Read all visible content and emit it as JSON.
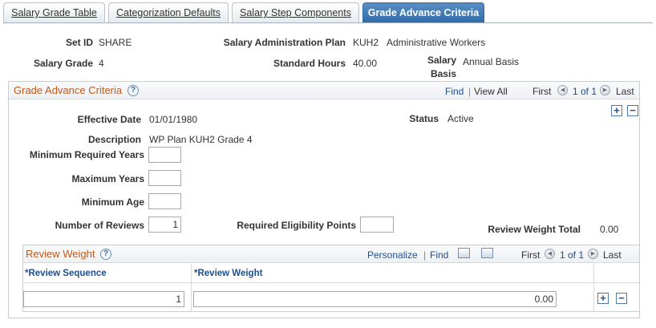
{
  "tabs": [
    {
      "label": "Salary Grade Table",
      "active": false
    },
    {
      "label": "Categorization Defaults",
      "active": false
    },
    {
      "label": "Salary Step Components",
      "active": false
    },
    {
      "label": "Grade Advance Criteria",
      "active": true
    }
  ],
  "header": {
    "setid_label": "Set ID",
    "setid_value": "SHARE",
    "sal_admin_plan_label": "Salary Administration Plan",
    "sal_admin_plan_code": "KUH2",
    "sal_admin_plan_desc": "Administrative Workers",
    "salary_grade_label": "Salary Grade",
    "salary_grade_value": "4",
    "std_hours_label": "Standard Hours",
    "std_hours_value": "40.00",
    "salary_basis_label_1": "Salary",
    "salary_basis_label_2": "Basis",
    "salary_basis_value": "Annual Basis"
  },
  "criteria": {
    "title": "Grade Advance Criteria",
    "help": "?",
    "find": "Find",
    "sep": "|",
    "view_all": "View All",
    "first": "First",
    "page_of": "1 of 1",
    "last": "Last",
    "add": "+",
    "remove": "−",
    "effective_date_label": "Effective Date",
    "effective_date_value": "01/01/1980",
    "status_label": "Status",
    "status_value": "Active",
    "description_label": "Description",
    "description_value": "WP Plan KUH2 Grade 4",
    "min_req_years_label": "Minimum Required Years",
    "min_req_years_value": "",
    "max_years_label": "Maximum Years",
    "max_years_value": "",
    "min_age_label": "Minimum Age",
    "min_age_value": "",
    "num_reviews_label": "Number of Reviews",
    "num_reviews_value": "1",
    "req_elig_points_label": "Required Eligibility Points",
    "req_elig_points_value": "",
    "review_weight_total_label": "Review Weight Total",
    "review_weight_total_value": "0.00"
  },
  "review_weight": {
    "title": "Review Weight",
    "help": "?",
    "personalize": "Personalize",
    "sep": "|",
    "find": "Find",
    "first": "First",
    "page_of": "1 of 1",
    "last": "Last",
    "columns": [
      "*Review Sequence",
      "*Review Weight"
    ],
    "rows": [
      {
        "sequence": "1",
        "weight": "0.00"
      }
    ],
    "add": "+",
    "remove": "−"
  },
  "icons": {
    "prev": "◀",
    "next": "▶"
  }
}
